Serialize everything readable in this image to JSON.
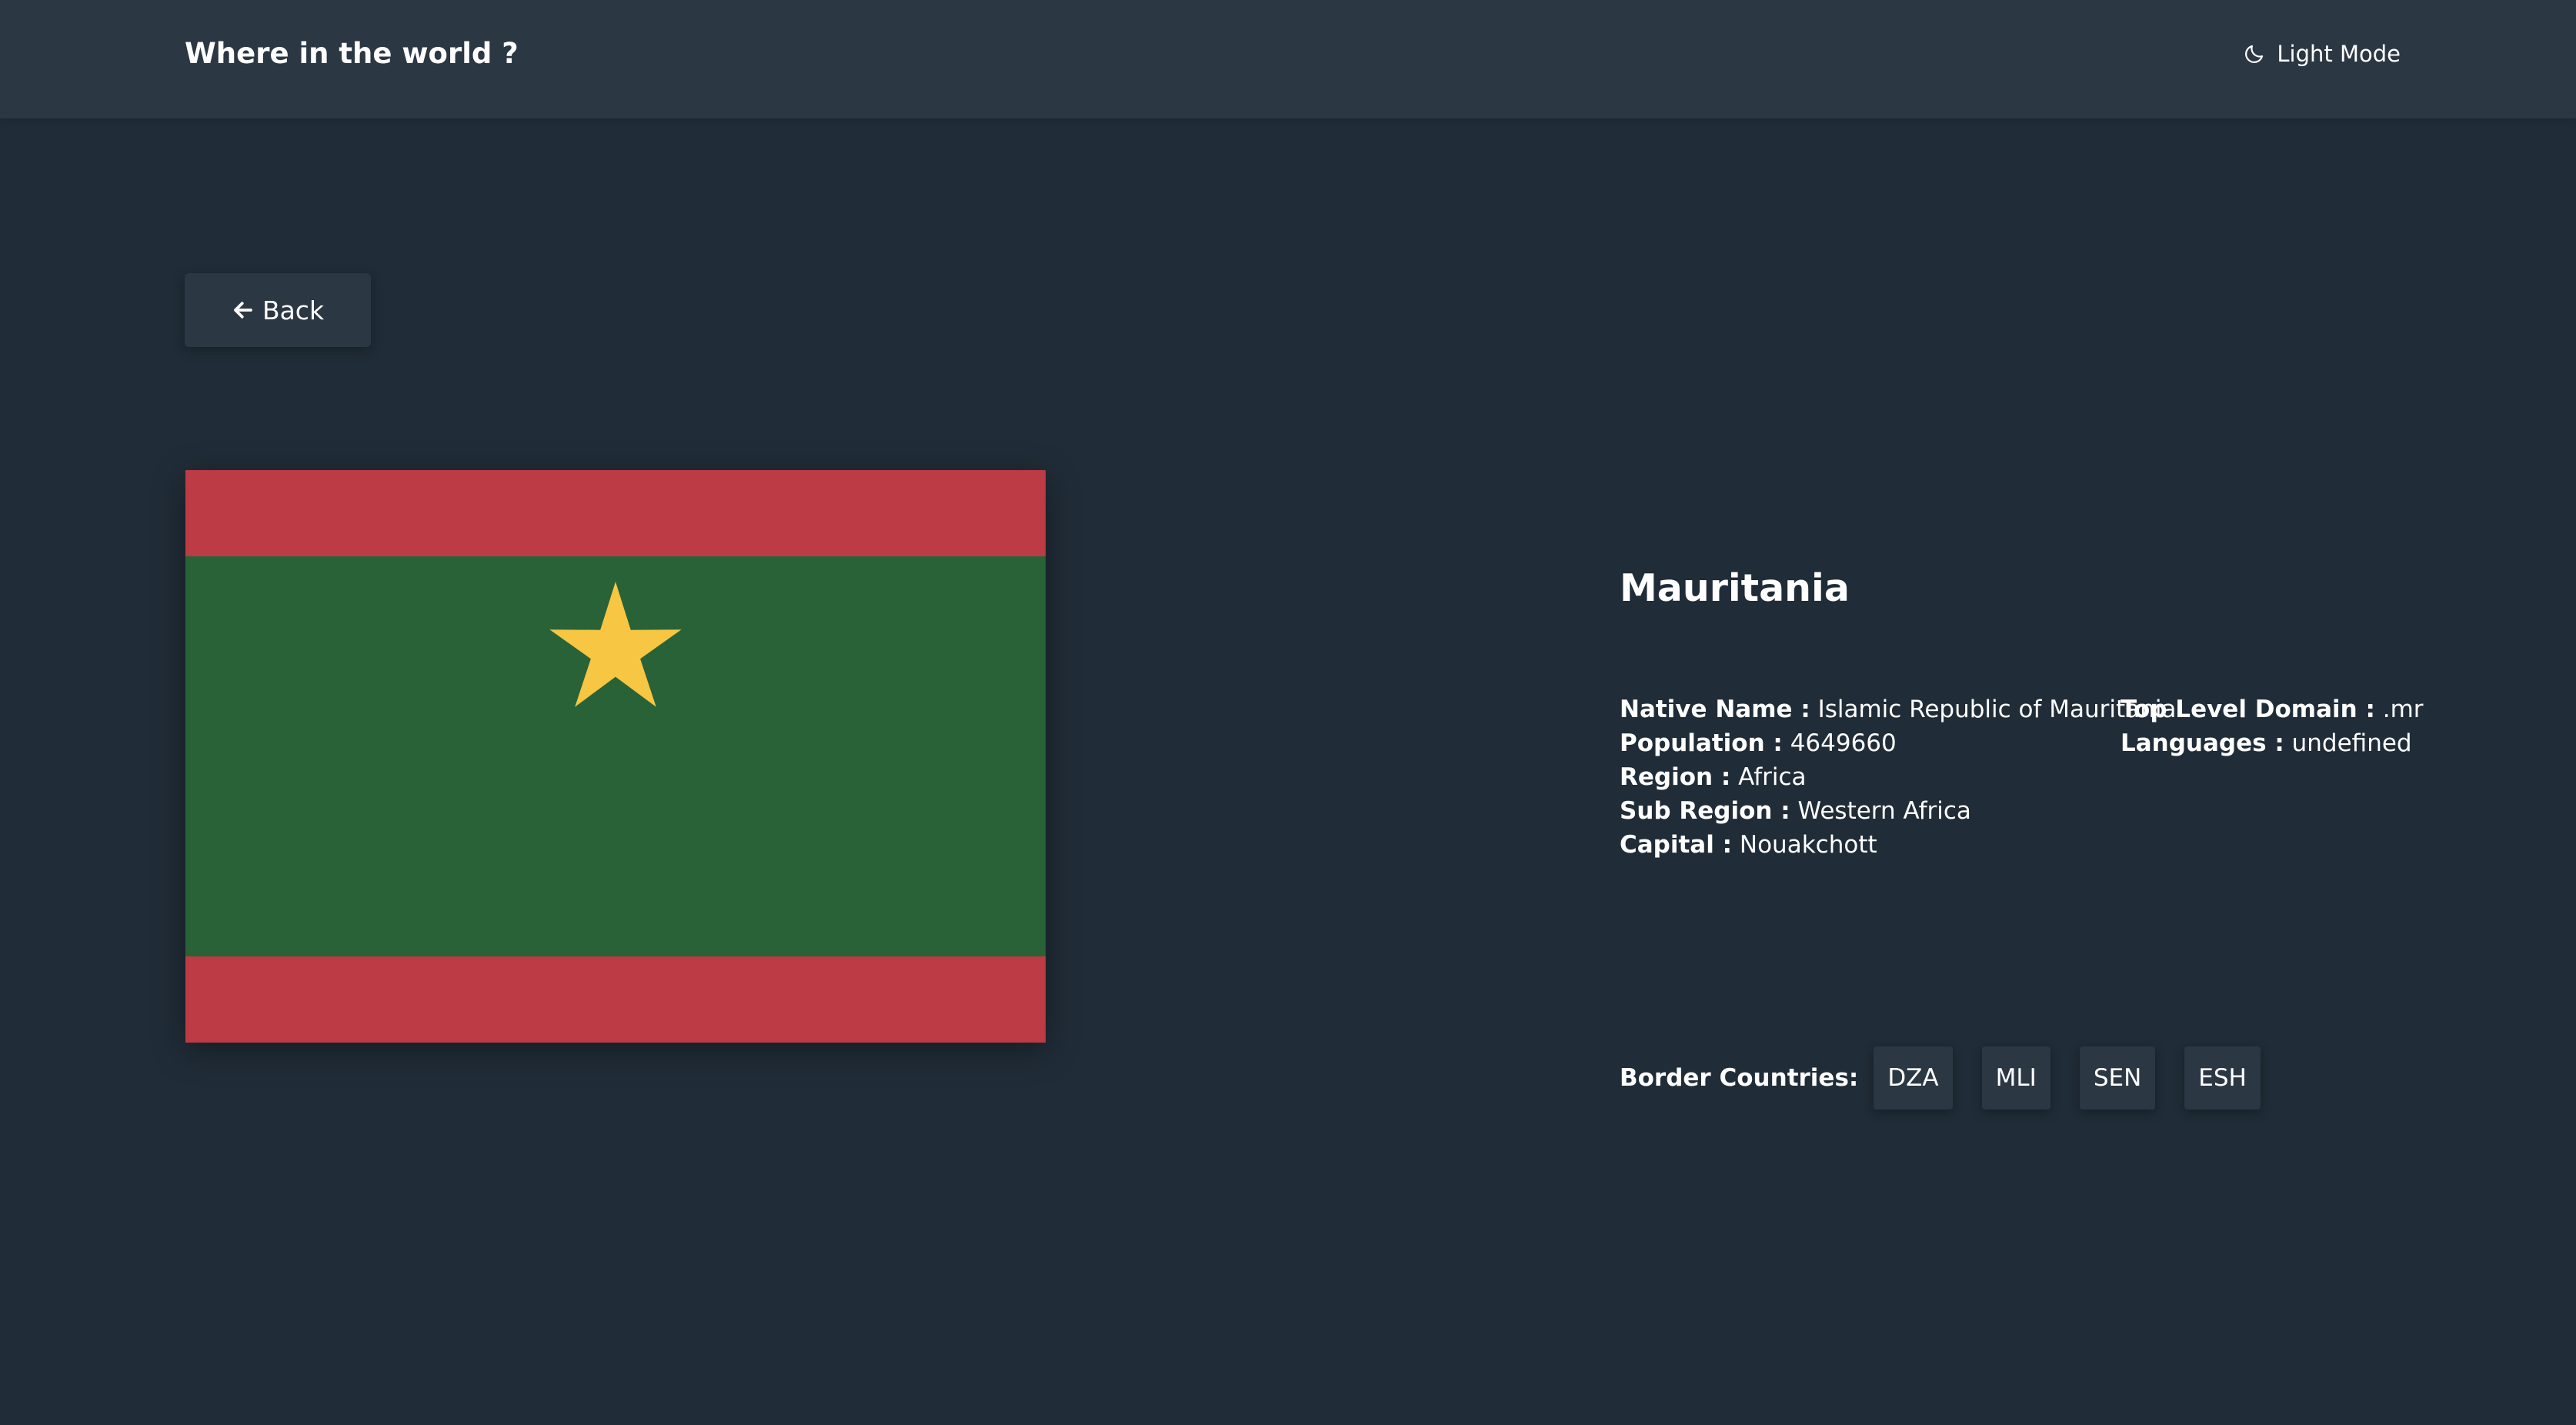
{
  "header": {
    "title": "Where in the world ?",
    "mode_toggle_label": "Light Mode",
    "mode_icon": "moon-icon"
  },
  "back_button": {
    "label": "Back",
    "icon": "arrow-left-icon"
  },
  "country": {
    "name": "Mauritania",
    "flag": {
      "colors": {
        "red": "#bd3b44",
        "green": "#2a6237",
        "gold": "#f7c643"
      }
    },
    "details_left": [
      {
        "label": "Native Name :",
        "value": "Islamic Republic of Mauritania"
      },
      {
        "label": "Population :",
        "value": "4649660"
      },
      {
        "label": "Region :",
        "value": "Africa"
      },
      {
        "label": "Sub Region :",
        "value": "Western Africa"
      },
      {
        "label": "Capital :",
        "value": "Nouakchott"
      }
    ],
    "details_right": [
      {
        "label": "Top Level Domain :",
        "value": ".mr"
      },
      {
        "label": "Languages :",
        "value": "undefined"
      }
    ],
    "border_countries_label": "Border Countries:",
    "border_countries": [
      "DZA",
      "MLI",
      "SEN",
      "ESH"
    ]
  },
  "theme": {
    "background": "#202c37",
    "element": "#2b3743",
    "text": "#ffffff"
  }
}
